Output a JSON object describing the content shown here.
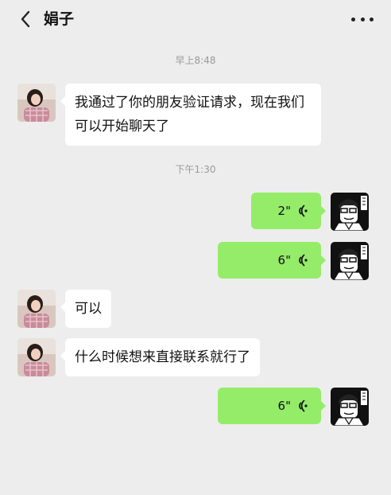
{
  "header": {
    "title": "娟子",
    "back_icon": "chevron-left-icon",
    "more_icon": "more-dots-icon"
  },
  "messages": {
    "time1": "早上8:48",
    "msg1": "我通过了你的朋友验证请求，现在我们可以开始聊天了",
    "time2": "下午1:30",
    "voice1_duration": "2\"",
    "voice2_duration": "6\"",
    "msg2": "可以",
    "msg3": "什么时候想来直接联系就行了",
    "voice3_duration": "6\""
  },
  "colors": {
    "background": "#ededed",
    "incoming_bubble": "#ffffff",
    "outgoing_bubble": "#95ec69"
  }
}
